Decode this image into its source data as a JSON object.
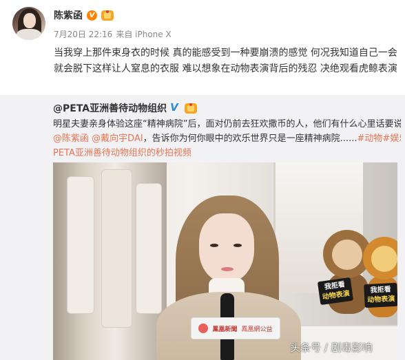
{
  "post": {
    "author": "陈紫函",
    "vip_badge": "V",
    "date": "7月20日 22:16",
    "source": "来自 iPhone X",
    "text": "当我穿上那件束身衣的时候 真的能感受到一种要崩溃的感觉 何况我知道自己一会就会脱下这样让人窒息的衣服   难以想象在动物表演背后的残忍 决绝观看虎鲸表演"
  },
  "retweet": {
    "author": "@PETA亚洲善待动物组织",
    "text_line1": "明星夫妻亲身体验这座“精神病院”后，面对仍前去狂欢撒币的人，他们有什么心里话要说？对话",
    "mention1": "@陈紫函",
    "mention2": "@戴向宇DAI",
    "text_line2_mid": "，告诉你为何你眼中的欢乐世界只是一座精神病院......",
    "hashtag1": "#动物",
    "hashtag2": "#娱乐#",
    "video_link": "PETA亚洲善待动物组织的秒拍视频"
  },
  "video": {
    "sign1_line1": "我拒看",
    "sign1_line2": "动物表演",
    "sign2_line1": "我拒看",
    "sign2_line2": "动物表演",
    "flag_brand": "鳳凰新聞",
    "flag_partner": "鳳凰網公益"
  },
  "watermark": "头条号 / 剧毒影响",
  "colors": {
    "link": "#eb7350",
    "verified_blue": "#2d8bd7",
    "vip_orange": "#ff8200",
    "retweet_bg": "#f2f2f5"
  }
}
